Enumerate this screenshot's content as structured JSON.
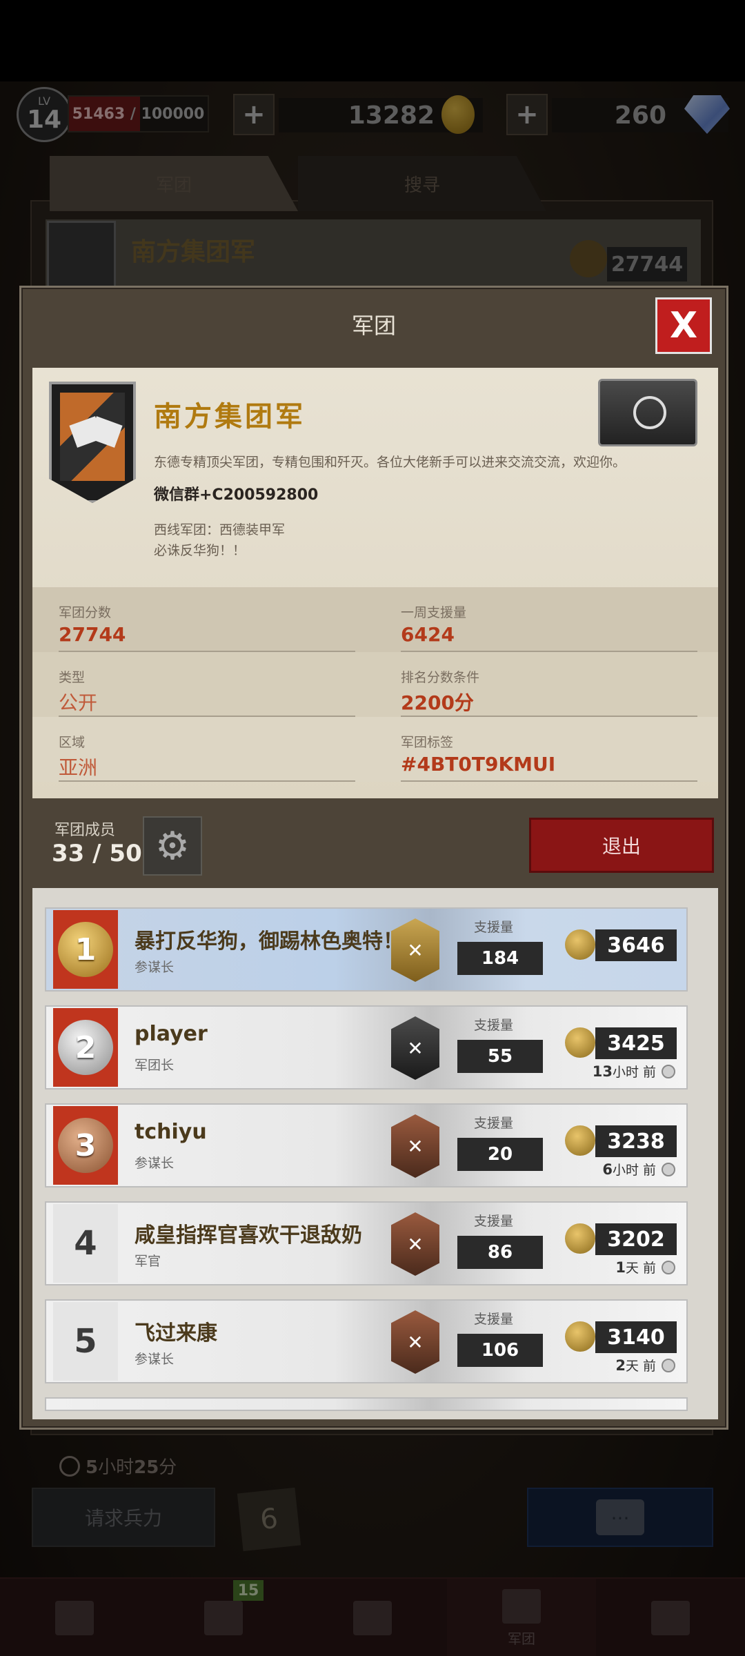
{
  "status": {
    "level_label": "LV",
    "level": "14",
    "xp_current": "51463",
    "xp_max": "/ 100000",
    "xp_fraction": 0.51463,
    "plus": "+",
    "gold": "13282",
    "gems": "260"
  },
  "background": {
    "tabs": [
      "军团",
      "搜寻"
    ],
    "guild_name": "南方集团军",
    "score": "27744"
  },
  "modal": {
    "title": "军团",
    "close": "X",
    "guild_name": "南方集团军",
    "desc_line1": "东德专精顶尖军团，专精包围和歼灭。各位大佬新手可以进来交流交流，欢迎你。",
    "desc_wechat": "微信群+C200592800",
    "desc_line3": "西线军团：西德装甲军",
    "desc_line4": "必诛反华狗！！",
    "stats": {
      "score_label": "军团分数",
      "score": "27744",
      "weekly_label": "一周支援量",
      "weekly": "6424",
      "type_label": "类型",
      "type": "公开",
      "req_label": "排名分数条件",
      "req": "2200分",
      "region_label": "区域",
      "region": "亚洲",
      "tag_label": "军团标签",
      "tag": "#4BT0T9KMUI"
    },
    "members_label": "军团成员",
    "members_count": "33 / 50",
    "quit": "退出"
  },
  "members": [
    {
      "rank": "1",
      "name": "暴打反华狗，御踢林色奥特！",
      "role": "参谋长",
      "support_label": "支援量",
      "support": "184",
      "score": "3646",
      "time": ""
    },
    {
      "rank": "2",
      "name": "player",
      "role": "军团长",
      "support_label": "支援量",
      "support": "55",
      "score": "3425",
      "time_num": "13",
      "time_unit": "小时 前"
    },
    {
      "rank": "3",
      "name": "tchiyu",
      "role": "参谋长",
      "support_label": "支援量",
      "support": "20",
      "score": "3238",
      "time_num": "6",
      "time_unit": "小时 前"
    },
    {
      "rank": "4",
      "name": "咸皇指挥官喜欢干退敌奶",
      "role": "军官",
      "support_label": "支援量",
      "support": "86",
      "score": "3202",
      "time_num": "1",
      "time_unit": "天 前"
    },
    {
      "rank": "5",
      "name": "飞过来康",
      "role": "参谋长",
      "support_label": "支援量",
      "support": "106",
      "score": "3140",
      "time_num": "2",
      "time_unit": "天 前"
    }
  ],
  "bottom": {
    "timer_h": "5",
    "timer_h_unit": "小时",
    "timer_m": "25",
    "timer_m_unit": "分",
    "request": "请求兵力",
    "card": "6",
    "chat": "...",
    "badge": "15",
    "nav_active": "军团"
  }
}
